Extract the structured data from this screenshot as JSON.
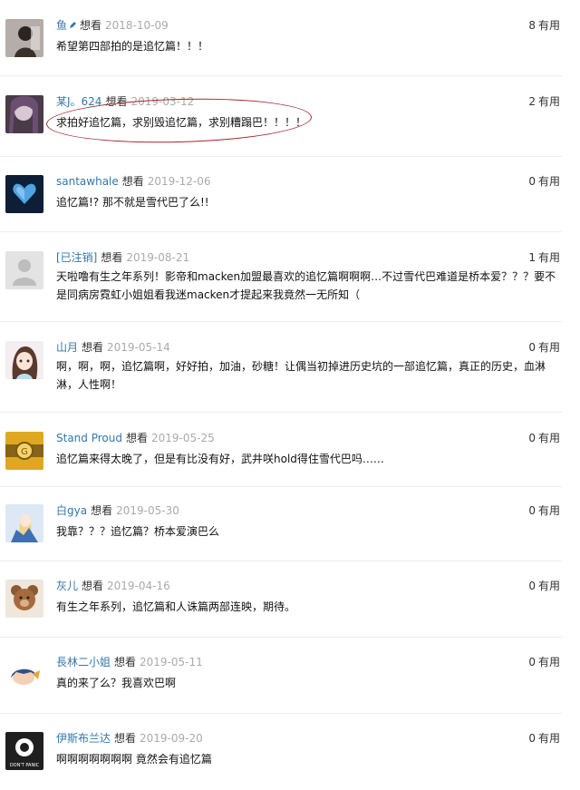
{
  "comments": [
    {
      "user": "鱼",
      "user_badge": "pen-icon",
      "rating": "想看",
      "time": "2018-10-09",
      "votes": "8",
      "votes_label": "有用",
      "text": "希望第四部拍的是追忆篇！！！",
      "avatar": "portrait-dark-avatar"
    },
    {
      "user": "某J。624",
      "rating": "想看",
      "time": "2019-03-12",
      "votes": "2",
      "votes_label": "有用",
      "text": "求拍好追忆篇，求别毁追忆篇，求别糟蹋巴！！！！",
      "avatar": "portrait-purple-avatar"
    },
    {
      "user": "santawhale",
      "rating": "想看",
      "time": "2019-12-06",
      "votes": "0",
      "votes_label": "有用",
      "text": "追忆篇!? 那不就是雪代巴了么!!",
      "avatar": "blue-heart-avatar"
    },
    {
      "user": "[已注销]",
      "rating": "想看",
      "time": "2019-08-21",
      "votes": "1",
      "votes_label": "有用",
      "text": "天啦噜有生之年系列！影帝和macken加盟最喜欢的追忆篇啊啊啊…不过雪代巴难道是桥本爱？？？要不是同病房霓虹小姐姐看我迷macken才提起来我竟然一无所知（",
      "avatar": "default-user-avatar"
    },
    {
      "user": "山月",
      "rating": "想看",
      "time": "2019-05-14",
      "votes": "0",
      "votes_label": "有用",
      "text": "啊，啊，啊，追忆篇啊，好好拍，加油，砂糖！让偶当初掉进历史坑的一部追忆篇，真正的历史，血淋淋，人性啊！",
      "avatar": "anime-girl-avatar"
    },
    {
      "user": "Stand Proud",
      "rating": "想看",
      "time": "2019-05-25",
      "votes": "0",
      "votes_label": "有用",
      "text": "追忆篇来得太晚了，但是有比没有好，武井咲hold得住雪代巴吗……",
      "avatar": "gold-emblem-avatar"
    },
    {
      "user": "白gya",
      "rating": "想看",
      "time": "2019-05-30",
      "votes": "0",
      "votes_label": "有用",
      "text": "我靠？？？追忆篇？桥本爱演巴么",
      "avatar": "anime-knight-avatar"
    },
    {
      "user": "灰儿",
      "rating": "想看",
      "time": "2019-04-16",
      "votes": "0",
      "votes_label": "有用",
      "text": "有生之年系列，追忆篇和人诛篇两部连映，期待。",
      "avatar": "teddy-bear-avatar"
    },
    {
      "user": "長林二小姐",
      "rating": "想看",
      "time": "2019-05-11",
      "votes": "0",
      "votes_label": "有用",
      "text": "真的来了么？我喜欢巴啊",
      "avatar": "chibi-character-avatar"
    },
    {
      "user": "伊斯布兰达",
      "rating": "想看",
      "time": "2019-09-20",
      "votes": "0",
      "votes_label": "有用",
      "text": "啊啊啊啊啊啊啊 竟然会有追忆篇",
      "avatar": "dont-panic-avatar",
      "avatar_text": "DON'T PANIC"
    }
  ],
  "colors": {
    "username": "#3377aa",
    "timestamp": "#aaaaaa",
    "highlight_circle": "#a3282d",
    "divider": "#ececec"
  }
}
